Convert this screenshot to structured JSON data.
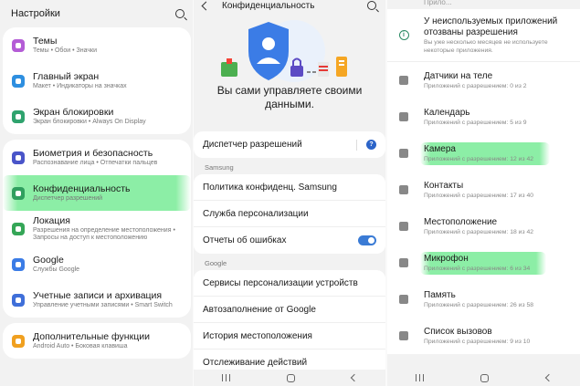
{
  "panel1": {
    "title": "Настройки",
    "groups": [
      [
        {
          "title": "Темы",
          "sub": "Темы • Обои • Значки",
          "color": "#b45cd6",
          "icon": "palette-icon"
        },
        {
          "title": "Главный экран",
          "sub": "Макет • Индикаторы на значках",
          "color": "#2e8fe0",
          "icon": "home-icon"
        },
        {
          "title": "Экран блокировки",
          "sub": "Экран блокировки • Always On Display",
          "color": "#2fa36e",
          "icon": "lock-screen-icon"
        }
      ],
      [
        {
          "title": "Биометрия и безопасность",
          "sub": "Распознавание лица • Отпечатки пальцев",
          "color": "#4a55c9",
          "icon": "shield-icon"
        },
        {
          "title": "Конфиденциальность",
          "sub": "Диспетчер разрешений",
          "color": "#2f9f5e",
          "icon": "privacy-icon"
        },
        {
          "title": "Локация",
          "sub": "Разрешения на определение местоположения • Запросы на доступ к местоположению",
          "color": "#35a657",
          "icon": "location-icon"
        },
        {
          "title": "Google",
          "sub": "Службы Google",
          "color": "#3b7ce6",
          "icon": "google-icon"
        },
        {
          "title": "Учетные записи и архивация",
          "sub": "Управление учетными записями • Smart Switch",
          "color": "#3f6fd9",
          "icon": "sync-icon"
        }
      ],
      [
        {
          "title": "Дополнительные функции",
          "sub": "Android Auto • Боковая клавиша",
          "color": "#f0a020",
          "icon": "gear-icon"
        }
      ]
    ]
  },
  "panel2": {
    "title": "Конфиденциальность",
    "lead": "Вы сами управляете своими данными.",
    "permission_manager": "Диспетчер разрешений",
    "section_samsung": "Samsung",
    "samsung_items": [
      "Политика конфиденц. Samsung",
      "Служба персонализации",
      "Отчеты об ошибках"
    ],
    "section_google": "Google",
    "google_items": [
      "Сервисы персонализации устройств",
      "Автозаполнение от Google",
      "История местоположения",
      "Отслеживание действий"
    ]
  },
  "panel3": {
    "top_label": "Прило...",
    "unused": {
      "title": "У неиспользуемых приложений отозваны разрешения",
      "sub": "Вы уже несколько месяцев не используете некоторые приложения."
    },
    "items": [
      {
        "title": "Датчики на теле",
        "sub": "Приложений с разрешением: 0 из 2",
        "icon": "heart-icon"
      },
      {
        "title": "Календарь",
        "sub": "Приложений с разрешением: 5 из 9",
        "icon": "calendar-icon"
      },
      {
        "title": "Камера",
        "sub": "Приложений с разрешением: 12 из 42",
        "icon": "camera-icon",
        "highlight": true
      },
      {
        "title": "Контакты",
        "sub": "Приложений с разрешением: 17 из 40",
        "icon": "contacts-icon"
      },
      {
        "title": "Местоположение",
        "sub": "Приложений с разрешением: 18 из 42",
        "icon": "location-icon"
      },
      {
        "title": "Микрофон",
        "sub": "Приложений с разрешением: 6 из 34",
        "icon": "microphone-icon",
        "highlight": true
      },
      {
        "title": "Память",
        "sub": "Приложений с разрешением: 26 из 58",
        "icon": "folder-icon"
      },
      {
        "title": "Список вызовов",
        "sub": "Приложений с разрешением: 9 из 10",
        "icon": "call-log-icon"
      }
    ]
  },
  "colors": {
    "accent_blue": "#2c64c8",
    "highlight_green": "#78eb96",
    "toggle_on": "#3a7bd5"
  }
}
